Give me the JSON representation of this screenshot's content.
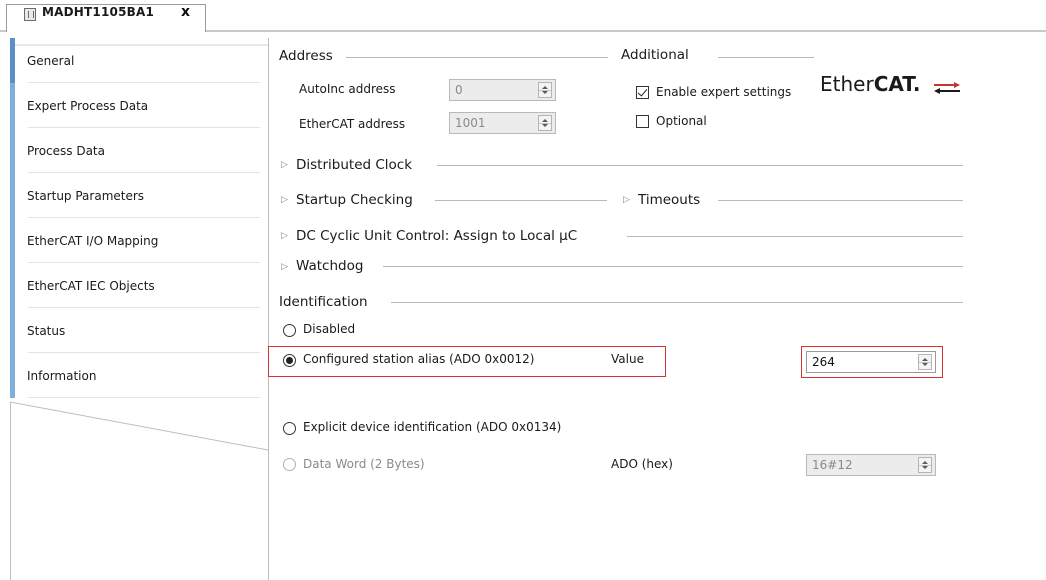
{
  "tab": {
    "title": "MADHT1105BA1",
    "close": "x"
  },
  "nav": {
    "items": [
      {
        "label": "General"
      },
      {
        "label": "Expert Process Data"
      },
      {
        "label": "Process Data"
      },
      {
        "label": "Startup Parameters"
      },
      {
        "label": "EtherCAT I/O Mapping"
      },
      {
        "label": "EtherCAT IEC Objects"
      },
      {
        "label": "Status"
      },
      {
        "label": "Information"
      }
    ]
  },
  "address": {
    "title": "Address",
    "autoinc_label": "AutoInc address",
    "autoinc_value": "0",
    "ethercat_label": "EtherCAT address",
    "ethercat_value": "1001"
  },
  "additional": {
    "title": "Additional",
    "expert_label": "Enable expert settings",
    "optional_label": "Optional"
  },
  "logo": {
    "text_light": "Ether",
    "text_bold": "CAT."
  },
  "sections": {
    "distributed_clock": "Distributed Clock",
    "startup_checking": "Startup Checking",
    "timeouts": "Timeouts",
    "dc_cyclic": "DC Cyclic Unit Control: Assign to Local µC",
    "watchdog": "Watchdog"
  },
  "identification": {
    "title": "Identification",
    "disabled_label": "Disabled",
    "alias_label": "Configured station alias (ADO 0x0012)",
    "alias_value_label": "Value",
    "alias_value": "264",
    "explicit_label": "Explicit device identification (ADO 0x0134)",
    "dataword_label": "Data Word (2 Bytes)",
    "ado_label": "ADO (hex)",
    "ado_value": "16#12"
  },
  "colors": {
    "highlight": "#d9312f",
    "nav_accent": "#7fb0dc"
  }
}
